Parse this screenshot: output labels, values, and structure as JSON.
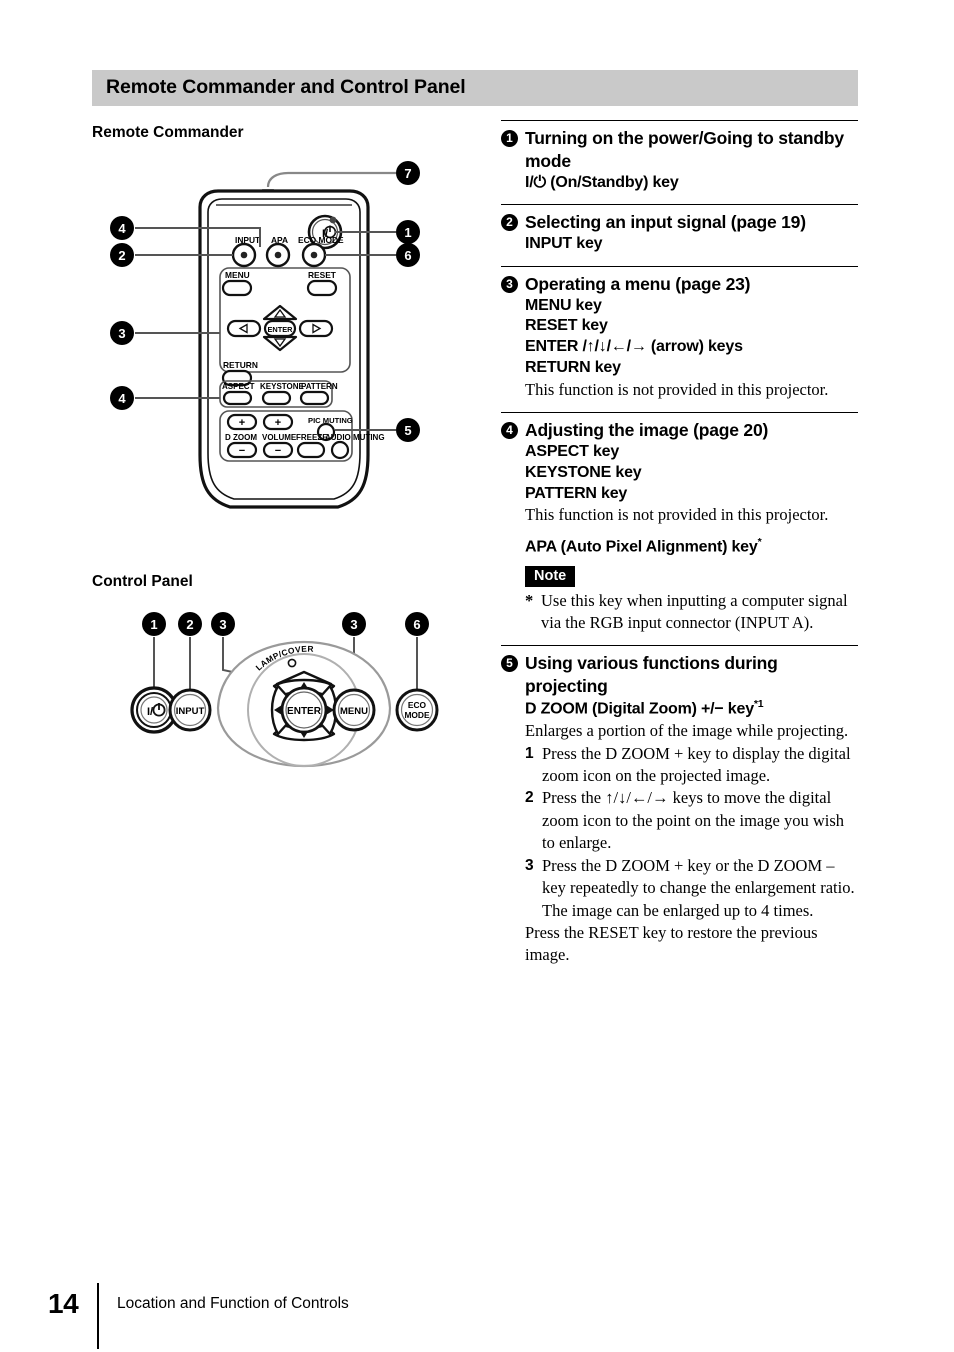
{
  "document": {
    "title": "Remote Commander and Control Panel",
    "page_number": "14",
    "footer_text": "Location and Function of Controls"
  },
  "figures": {
    "remote": {
      "heading": "Remote Commander",
      "callouts": [
        "7",
        "4",
        "1",
        "2",
        "6",
        "3",
        "4",
        "5"
      ],
      "button_labels": {
        "input": "INPUT",
        "apa": "APA",
        "eco_mode": "ECO MODE",
        "power": "I/⏻",
        "menu": "MENU",
        "reset": "RESET",
        "enter": "ENTER",
        "return": "RETURN",
        "aspect": "ASPECT",
        "keystone": "KEYSTONE",
        "pattern": "PATTERN",
        "d_zoom": "D ZOOM",
        "volume": "VOLUME",
        "freeze": "FREEZE",
        "pic_muting": "PIC MUTING",
        "audio_muting": "AUDIO MUTING",
        "plus": "+",
        "minus": "−"
      }
    },
    "control_panel": {
      "heading": "Control Panel",
      "callouts": [
        "1",
        "2",
        "3",
        "3",
        "6"
      ],
      "button_labels": {
        "power": "I/⏻",
        "input": "INPUT",
        "enter": "ENTER",
        "menu": "MENU",
        "eco_mode_line1": "ECO",
        "eco_mode_line2": "MODE",
        "lamp_cover": "LAMP/COVER"
      }
    }
  },
  "sections": [
    {
      "number": "1",
      "title": "Turning on the power/Going to standby mode",
      "lines": [
        {
          "style": "key",
          "text": "I/⏻ (On/Standby) key"
        }
      ]
    },
    {
      "number": "2",
      "title": "Selecting an input signal (page 19)",
      "lines": [
        {
          "style": "key",
          "text": "INPUT key"
        }
      ]
    },
    {
      "number": "3",
      "title": "Operating a menu (page 23)",
      "lines": [
        {
          "style": "key",
          "text": "MENU key"
        },
        {
          "style": "key",
          "text": "RESET key"
        },
        {
          "style": "key",
          "text": "ENTER /↑/↓/←/→ (arrow) keys"
        },
        {
          "style": "key",
          "text": "RETURN key"
        },
        {
          "style": "body",
          "text": "This function is not provided in this projector."
        }
      ]
    },
    {
      "number": "4",
      "title": "Adjusting the image (page 20)",
      "lines": [
        {
          "style": "key",
          "text": "ASPECT key"
        },
        {
          "style": "key",
          "text": "KEYSTONE key"
        },
        {
          "style": "key",
          "text": "PATTERN key"
        },
        {
          "style": "body",
          "text": "This function is not provided in this projector."
        },
        {
          "style": "key",
          "text": "APA (Auto Pixel Alignment) key",
          "sup": "*"
        }
      ],
      "note": {
        "badge": "Note",
        "mark": "*",
        "text": "Use this key when inputting a computer signal via the RGB input connector (INPUT A)."
      }
    },
    {
      "number": "5",
      "title": "Using various functions during projecting",
      "lines": [
        {
          "style": "key",
          "text": "D ZOOM (Digital Zoom) +/− key",
          "sup": "*1"
        },
        {
          "style": "body",
          "text": "Enlarges a portion of the image while projecting."
        }
      ],
      "steps": [
        {
          "num": "1",
          "text": "Press the D ZOOM + key to display the digital zoom icon on the projected image."
        },
        {
          "num": "2",
          "text": "Press the ↑/↓/←/→ keys to move the digital zoom icon to the point on the image you wish to enlarge."
        },
        {
          "num": "3",
          "text": "Press the D ZOOM + key or the D ZOOM – key repeatedly to change the enlargement ratio. The image can be enlarged up to 4 times."
        }
      ],
      "tail": "Press the RESET key to restore the previous image."
    }
  ]
}
